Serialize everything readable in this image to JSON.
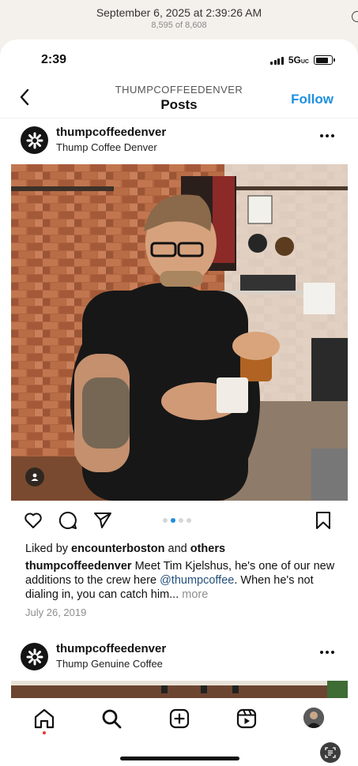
{
  "photos_header": {
    "date": "September 6, 2025 at 2:39:26 AM",
    "count": "8,595 of 8,608"
  },
  "status_bar": {
    "time": "2:39",
    "network": "5G",
    "network_suffix": "UC"
  },
  "nav": {
    "username": "THUMPCOFFEEDENVER",
    "title": "Posts",
    "follow_label": "Follow"
  },
  "post1": {
    "username": "thumpcoffeedenver",
    "subtitle": "Thump Coffee Denver",
    "liked_prefix": "Liked by",
    "liked_user": "encounterboston",
    "liked_and": "and",
    "liked_others": "others",
    "caption_user": "thumpcoffeedenver",
    "caption_text": "Meet Tim Kjelshus, he's one of our new additions to the crew here",
    "caption_mention": "@thumpcoffee",
    "caption_text2": ". When he's not dialing in,  you can catch him...",
    "more_label": "more",
    "date": "July 26, 2019",
    "carousel": {
      "count": 4,
      "active_index": 1
    }
  },
  "post2": {
    "username": "thumpcoffeedenver",
    "subtitle": "Thump Genuine Coffee"
  },
  "colors": {
    "accent": "#1d8fe0",
    "notification": "#e33333"
  },
  "icons": [
    "back-chevron-icon",
    "more-icon",
    "heart-icon",
    "comment-icon",
    "share-icon",
    "bookmark-icon",
    "home-icon",
    "search-icon",
    "create-icon",
    "reels-icon",
    "profile-icon",
    "tag-person-icon"
  ]
}
